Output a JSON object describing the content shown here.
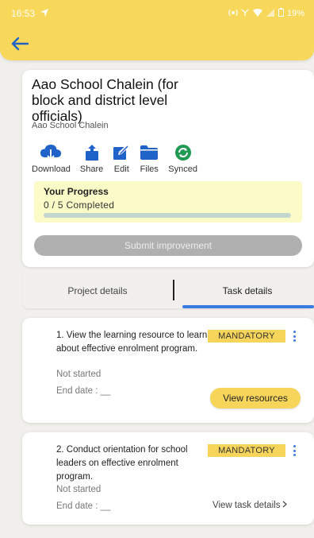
{
  "status_bar": {
    "time": "16:53",
    "battery": "19%"
  },
  "project": {
    "title": "Aao School Chalein (for block and district level officials)",
    "subtitle": "Aao School Chalein",
    "actions": [
      {
        "label": "Download",
        "icon": "cloud-download-icon"
      },
      {
        "label": "Share",
        "icon": "share-icon"
      },
      {
        "label": "Edit",
        "icon": "edit-icon"
      },
      {
        "label": "Files",
        "icon": "folder-icon"
      },
      {
        "label": "Synced",
        "icon": "synced-icon"
      }
    ],
    "progress": {
      "label": "Your Progress",
      "count": "0 / 5 Completed",
      "fraction": 0
    },
    "submit_label": "Submit improvement"
  },
  "tabs": [
    {
      "label": "Project details",
      "active": false
    },
    {
      "label": "Task details",
      "active": true
    }
  ],
  "tasks": [
    {
      "title": "1. View the learning resource to learn about effective enrolment program.",
      "badge": "MANDATORY",
      "status": "Not started",
      "end_date": "End date : __",
      "action": "View resources"
    },
    {
      "title": "2. Conduct orientation for school leaders on effective enrolment program.",
      "badge": "MANDATORY",
      "status": "Not started",
      "end_date": "End date : __",
      "action": "View task details"
    }
  ],
  "colors": {
    "accent_yellow": "#f7d85a",
    "icon_blue": "#1f63c9",
    "synced_green": "#1f9a52",
    "tab_indicator": "#3a7be0"
  }
}
